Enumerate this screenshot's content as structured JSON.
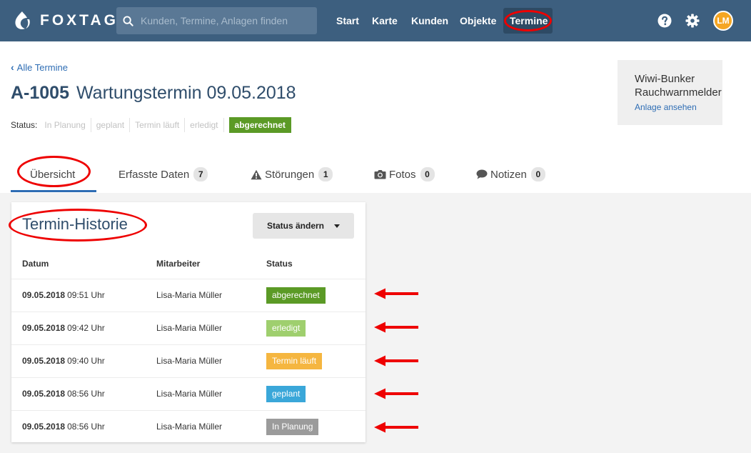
{
  "app": {
    "logo_text": "FOXTAG"
  },
  "search": {
    "placeholder": "Kunden, Termine, Anlagen finden"
  },
  "nav": {
    "items": [
      "Start",
      "Karte",
      "Kunden",
      "Objekte",
      "Termine"
    ],
    "active": "Termine"
  },
  "user": {
    "initials": "LM"
  },
  "breadcrumb": {
    "back_label": "Alle Termine"
  },
  "title": {
    "code": "A-1005",
    "text": "Wartungstermin 09.05.2018"
  },
  "status": {
    "label": "Status:",
    "steps": [
      "In Planung",
      "geplant",
      "Termin läuft",
      "erledigt"
    ],
    "current": "abgerechnet"
  },
  "asset": {
    "name_line1": "Wiwi-Bunker",
    "name_line2": "Rauchwarnmelder",
    "link": "Anlage ansehen"
  },
  "tabs": [
    {
      "label": "Übersicht",
      "count": ""
    },
    {
      "label": "Erfasste Daten",
      "count": "7"
    },
    {
      "label": "Störungen",
      "count": "1"
    },
    {
      "label": "Fotos",
      "count": "0"
    },
    {
      "label": "Notizen",
      "count": "0"
    }
  ],
  "history": {
    "title": "Termin-Historie",
    "button": "Status ändern",
    "columns": [
      "Datum",
      "Mitarbeiter",
      "Status"
    ],
    "rows": [
      {
        "date": "09.05.2018",
        "time": "09:51 Uhr",
        "employee": "Lisa-Maria Müller",
        "status": "abgerechnet",
        "color": "#5b9a26"
      },
      {
        "date": "09.05.2018",
        "time": "09:42 Uhr",
        "employee": "Lisa-Maria Müller",
        "status": "erledigt",
        "color": "#9fcf6e"
      },
      {
        "date": "09.05.2018",
        "time": "09:40 Uhr",
        "employee": "Lisa-Maria Müller",
        "status": "Termin läuft",
        "color": "#f5b640"
      },
      {
        "date": "09.05.2018",
        "time": "08:56 Uhr",
        "employee": "Lisa-Maria Müller",
        "status": "geplant",
        "color": "#3aa7d9"
      },
      {
        "date": "09.05.2018",
        "time": "08:56 Uhr",
        "employee": "Lisa-Maria Müller",
        "status": "In Planung",
        "color": "#9b9b9b"
      }
    ]
  },
  "colors": {
    "topbar": "#3d5f7f",
    "link": "#2e6db4",
    "title": "#2f4d6b",
    "annotation": "#e00000"
  }
}
